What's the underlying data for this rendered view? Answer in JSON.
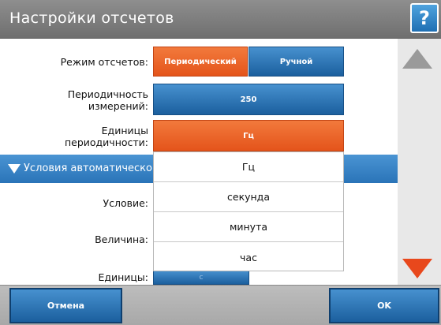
{
  "title": "Настройки отсчетов",
  "help_label": "?",
  "rows": {
    "mode_label": "Режим отсчетов:",
    "mode_options": [
      "Периодический",
      "Ручной"
    ],
    "mode_selected": "Периодический",
    "period_label": "Периодичность измерений:",
    "period_value": "250",
    "units_label": "Единицы периодичности:",
    "units_value": "Гц",
    "condition_label": "Условие:",
    "magnitude_label": "Величина:",
    "units2_label": "Единицы:",
    "units2_value": "с"
  },
  "section": {
    "label": "Условия автоматического"
  },
  "dropdown": {
    "options": [
      "Гц",
      "секунда",
      "минута",
      "час"
    ]
  },
  "footer": {
    "cancel_label": "Отмена",
    "ok_label": "OK"
  },
  "colors": {
    "accent_blue": "#2a74b8",
    "accent_orange": "#e4541b",
    "titlebar": "#7a7a7a"
  },
  "icons": {
    "scroll_up": "triangle-up-icon",
    "scroll_down": "triangle-down-icon",
    "section_toggle": "triangle-down-icon"
  }
}
